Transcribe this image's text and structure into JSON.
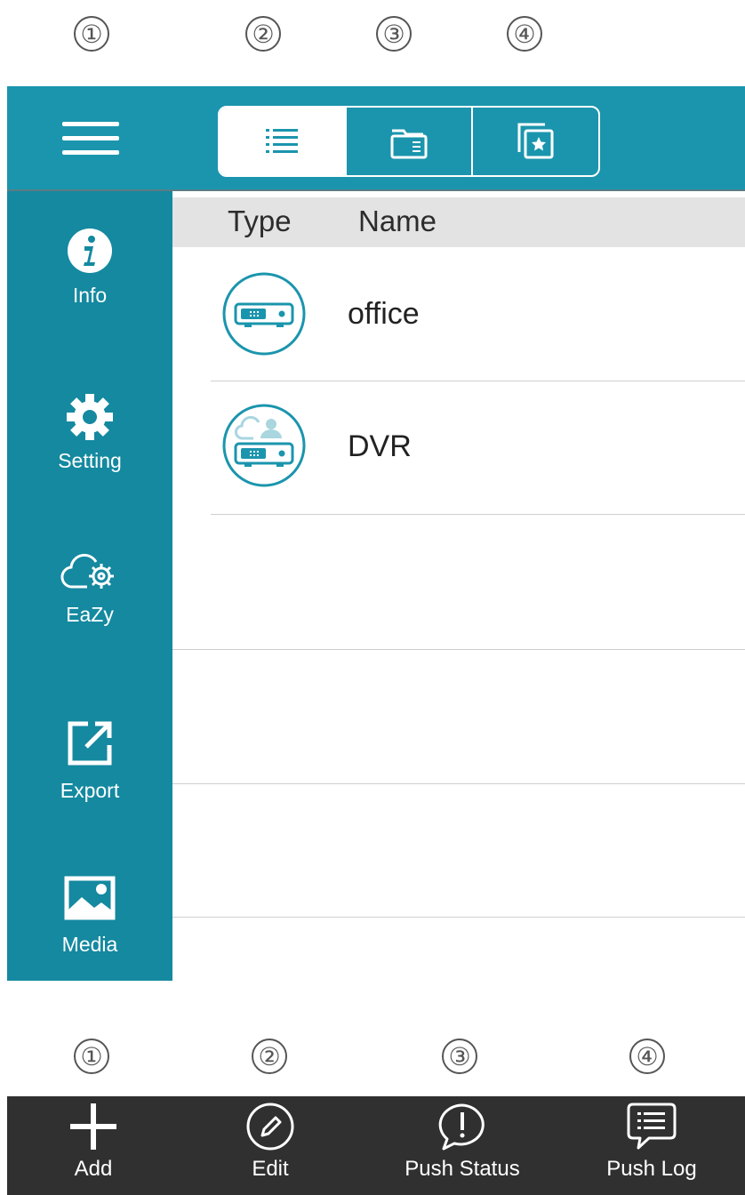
{
  "top_callouts": [
    "①",
    "②",
    "③",
    "④"
  ],
  "bottom_callouts": [
    "①",
    "②",
    "③",
    "④"
  ],
  "header": {
    "view_tabs": [
      {
        "icon": "list-view-icon",
        "active": true
      },
      {
        "icon": "folder-view-icon",
        "active": false
      },
      {
        "icon": "favorites-view-icon",
        "active": false
      }
    ]
  },
  "sidebar": {
    "items": [
      {
        "label": "Info",
        "icon": "info-icon"
      },
      {
        "label": "Setting",
        "icon": "gear-icon"
      },
      {
        "label": "EaZy",
        "icon": "cloud-gear-icon"
      },
      {
        "label": "Export",
        "icon": "export-icon"
      },
      {
        "label": "Media",
        "icon": "image-icon"
      }
    ]
  },
  "list": {
    "columns": [
      "Type",
      "Name"
    ],
    "rows": [
      {
        "name": "office",
        "type_icon": "recorder-device-icon"
      },
      {
        "name": "DVR",
        "type_icon": "cloud-recorder-device-icon"
      }
    ]
  },
  "toolbar": {
    "items": [
      {
        "label": "Add",
        "icon": "plus-icon"
      },
      {
        "label": "Edit",
        "icon": "pencil-icon"
      },
      {
        "label": "Push Status",
        "icon": "alert-bubble-icon"
      },
      {
        "label": "Push Log",
        "icon": "log-bubble-icon"
      }
    ]
  },
  "colors": {
    "accent": "#1b95ad",
    "sidebar": "#1489a0",
    "toolbar": "#303030",
    "header_row": "#e3e3e3"
  }
}
